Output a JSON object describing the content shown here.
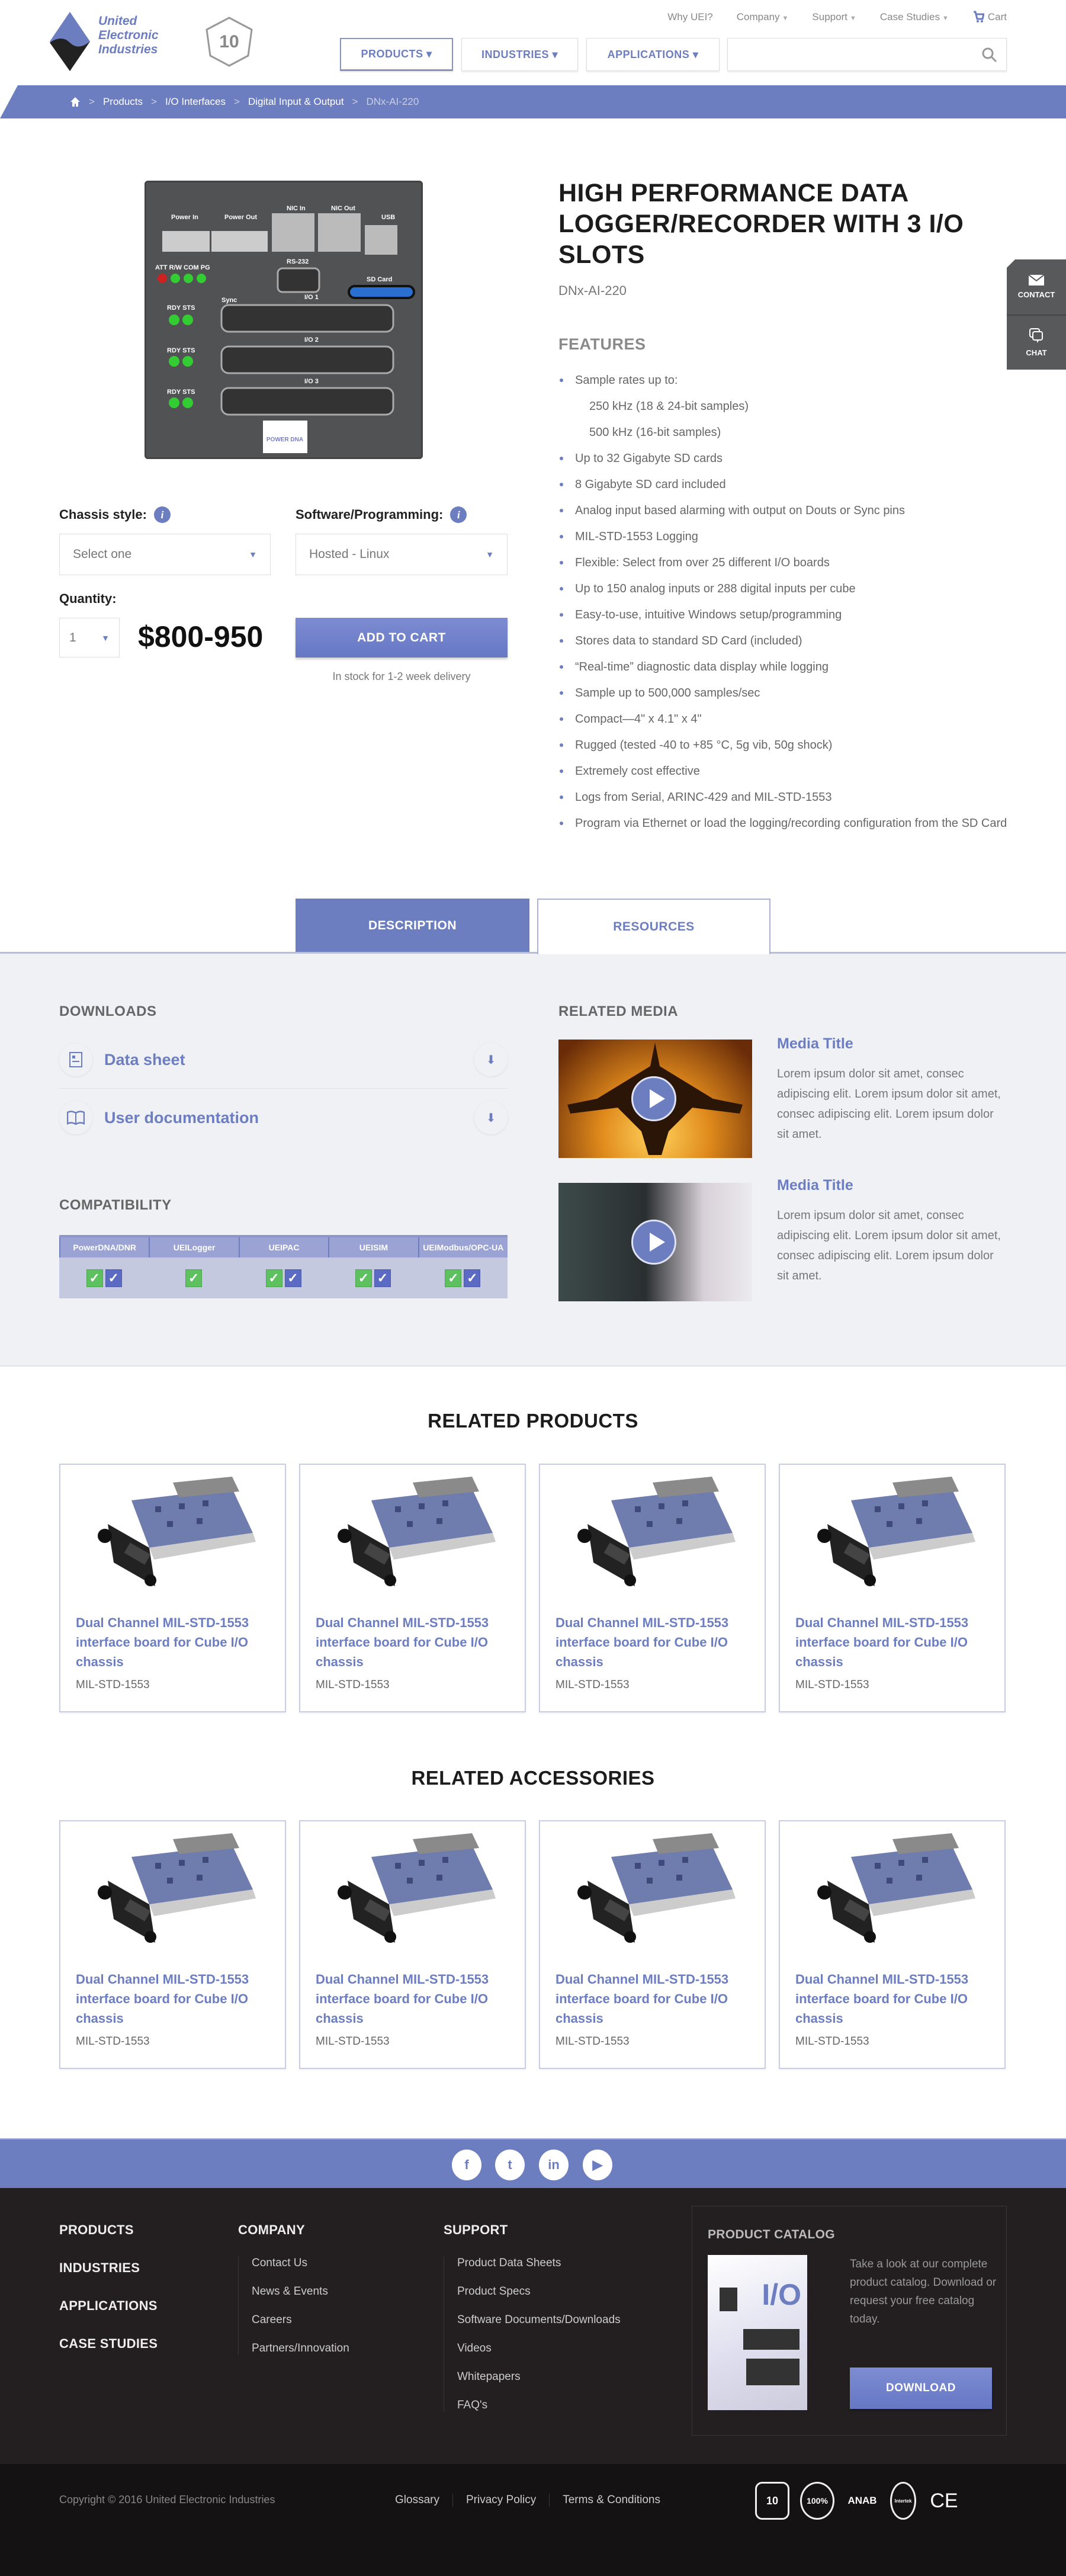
{
  "brand": {
    "name_lines": [
      "United",
      "Electronic",
      "Industries"
    ],
    "badge": "10",
    "accent": "#6c7ec0"
  },
  "topnav": [
    {
      "label": "Why UEI?",
      "caret": false
    },
    {
      "label": "Company",
      "caret": true
    },
    {
      "label": "Support",
      "caret": true
    },
    {
      "label": "Case Studies",
      "caret": true
    },
    {
      "label": "Cart",
      "caret": false
    }
  ],
  "mainnav": [
    {
      "label": "PRODUCTS ▾"
    },
    {
      "label": "INDUSTRIES ▾"
    },
    {
      "label": "APPLICATIONS ▾"
    }
  ],
  "search": {
    "placeholder": ""
  },
  "breadcrumb": [
    "Products",
    "I/O Interfaces",
    "Digital Input & Output",
    "DNx-AI-220"
  ],
  "product": {
    "title": "HIGH PERFORMANCE DATA LOGGER/RECORDER WITH 3 I/O SLOTS",
    "sku": "DNx-AI-220",
    "features_heading": "FEATURES",
    "features": [
      {
        "text": "Sample rates up to:",
        "sub": false
      },
      {
        "text": "250 kHz (18 & 24-bit samples)",
        "sub": true
      },
      {
        "text": "500 kHz (16-bit samples)",
        "sub": true
      },
      {
        "text": "Up to 32 Gigabyte SD cards",
        "sub": false
      },
      {
        "text": "8 Gigabyte SD card included",
        "sub": false
      },
      {
        "text": "Analog input based alarming with output on Douts or Sync pins",
        "sub": false
      },
      {
        "text": "MIL-STD-1553 Logging",
        "sub": false
      },
      {
        "text": "Flexible: Select from over 25 different I/O boards",
        "sub": false
      },
      {
        "text": "Up to 150 analog inputs or 288 digital inputs per cube",
        "sub": false
      },
      {
        "text": "Easy-to-use, intuitive Windows setup/programming",
        "sub": false
      },
      {
        "text": "Stores data to standard SD Card (included)",
        "sub": false
      },
      {
        "text": "“Real-time” diagnostic data display while logging",
        "sub": false
      },
      {
        "text": "Sample up to 500,000 samples/sec",
        "sub": false
      },
      {
        "text": "Compact—4\" x 4.1\" x 4\"",
        "sub": false
      },
      {
        "text": "Rugged (tested -40 to +85 °C, 5g vib, 50g shock)",
        "sub": false
      },
      {
        "text": "Extremely cost effective",
        "sub": false
      },
      {
        "text": "Logs from Serial, ARINC-429 and MIL-STD-1553",
        "sub": false
      },
      {
        "text": "Program via Ethernet or load the logging/recording configuration from the SD Card",
        "sub": false
      }
    ],
    "chassis_label": "Chassis style:",
    "chassis_value": "Select one",
    "software_label": "Software/Programming:",
    "software_value": "Hosted - Linux",
    "quantity_label": "Quantity:",
    "quantity_value": "1",
    "price": "$800-950",
    "add_to_cart": "ADD TO CART",
    "stock": "In stock for 1-2 week delivery",
    "image_labels": {
      "power_in": "Power In",
      "power_out": "Power Out",
      "nic_in": "NIC In",
      "nic_out": "NIC Out",
      "usb": "USB",
      "rs232": "RS-232",
      "sd": "SD Card",
      "leds": "ATT R/W COM PG",
      "sync": "Sync",
      "rdy": "RDY STS",
      "io1": "I/O 1",
      "io2": "I/O 2",
      "io3": "I/O 3",
      "logo": "POWER DNA"
    }
  },
  "side_widget": {
    "contact": "CONTACT",
    "chat": "CHAT"
  },
  "tabs": [
    {
      "label": "DESCRIPTION",
      "active": false
    },
    {
      "label": "RESOURCES",
      "active": true
    }
  ],
  "downloads": {
    "heading": "DOWNLOADS",
    "items": [
      {
        "label": "Data sheet",
        "icon": "document-icon"
      },
      {
        "label": "User documentation",
        "icon": "book-icon"
      }
    ]
  },
  "compatibility": {
    "heading": "COMPATIBILITY",
    "columns": [
      {
        "name": "PowerDNA/DNR",
        "dna": true,
        "dnr": true
      },
      {
        "name": "UEILogger",
        "dna": true,
        "dnr": false
      },
      {
        "name": "UEIPAC",
        "dna": true,
        "dnr": true
      },
      {
        "name": "UEISIM",
        "dna": true,
        "dnr": true
      },
      {
        "name": "UEIModbus/OPC-UA",
        "dna": true,
        "dnr": true
      }
    ]
  },
  "related_media": {
    "heading": "RELATED MEDIA",
    "items": [
      {
        "title": "Media Title",
        "text": "Lorem ipsum dolor sit amet, consec adipiscing elit. Lorem ipsum dolor sit amet, consec adipiscing elit. Lorem ipsum dolor sit amet."
      },
      {
        "title": "Media Title",
        "text": "Lorem ipsum dolor sit amet, consec adipiscing elit. Lorem ipsum dolor sit amet, consec adipiscing elit. Lorem ipsum dolor sit amet."
      }
    ]
  },
  "related_products": {
    "heading": "RELATED PRODUCTS",
    "items": [
      {
        "title": "Dual Channel MIL-STD-1553 interface board for Cube I/O chassis",
        "sku": "MIL-STD-1553"
      },
      {
        "title": "Dual Channel MIL-STD-1553 interface board for Cube I/O chassis",
        "sku": "MIL-STD-1553"
      },
      {
        "title": "Dual Channel MIL-STD-1553 interface board for Cube I/O chassis",
        "sku": "MIL-STD-1553"
      },
      {
        "title": "Dual Channel MIL-STD-1553 interface board for Cube I/O chassis",
        "sku": "MIL-STD-1553"
      }
    ]
  },
  "related_accessories": {
    "heading": "RELATED ACCESSORIES",
    "items": [
      {
        "title": "Dual Channel MIL-STD-1553 interface board for Cube I/O chassis",
        "sku": "MIL-STD-1553"
      },
      {
        "title": "Dual Channel MIL-STD-1553 interface board for Cube I/O chassis",
        "sku": "MIL-STD-1553"
      },
      {
        "title": "Dual Channel MIL-STD-1553 interface board for Cube I/O chassis",
        "sku": "MIL-STD-1553"
      },
      {
        "title": "Dual Channel MIL-STD-1553 interface board for Cube I/O chassis",
        "sku": "MIL-STD-1553"
      }
    ]
  },
  "social": [
    {
      "icon": "facebook-icon",
      "glyph": "f"
    },
    {
      "icon": "twitter-icon",
      "glyph": "t"
    },
    {
      "icon": "linkedin-icon",
      "glyph": "in"
    },
    {
      "icon": "youtube-icon",
      "glyph": "▶"
    }
  ],
  "footer": {
    "main_links": [
      "PRODUCTS",
      "INDUSTRIES",
      "APPLICATIONS",
      "CASE STUDIES"
    ],
    "company": {
      "heading": "COMPANY",
      "links": [
        "Contact Us",
        "News & Events",
        "Careers",
        "Partners/Innovation"
      ]
    },
    "support": {
      "heading": "SUPPORT",
      "links": [
        "Product Data Sheets",
        "Product Specs",
        "Software Documents/Downloads",
        "Videos",
        "Whitepapers",
        "FAQ's"
      ]
    },
    "catalog": {
      "heading": "PRODUCT CATALOG",
      "text": "Take a look at our complete product catalog. Download or request your free catalog today.",
      "button": "DOWNLOAD",
      "cover_text": "I/O"
    },
    "copyright": "Copyright © 2016 United Electronic Industries",
    "bottom_links": [
      "Glossary",
      "Privacy Policy",
      "Terms & Conditions"
    ],
    "certs": [
      "10",
      "100%",
      "ANAB",
      "Intertek",
      "CE"
    ]
  }
}
